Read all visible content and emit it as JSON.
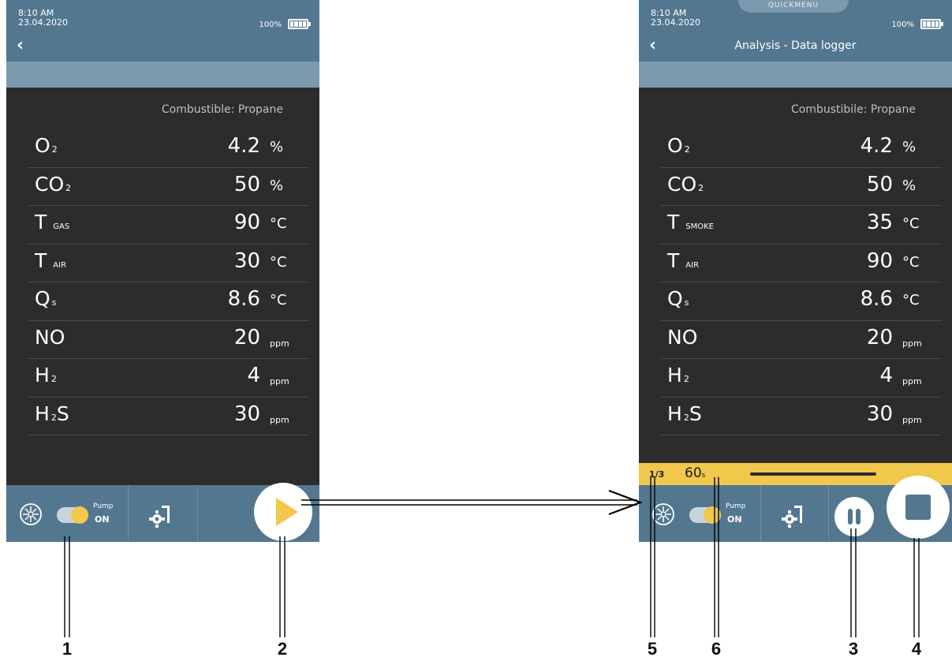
{
  "status": {
    "time": "8:10 AM",
    "date": "23.04.2020",
    "battery_percent": "100%",
    "battery_level": 1.0
  },
  "left_screen": {
    "fuel": "Combustible: Propane",
    "rows": [
      {
        "param": "O",
        "sub": "2",
        "value": "4.2",
        "unit": "%"
      },
      {
        "param": "CO",
        "sub": "2",
        "value": "50",
        "unit": "%"
      },
      {
        "param": "T",
        "sub_label": "GAS",
        "value": "90",
        "unit": "°C"
      },
      {
        "param": "T",
        "sub_label": "AIR",
        "value": "30",
        "unit": "°C"
      },
      {
        "param": "Q",
        "sub": "s",
        "value": "8.6",
        "unit": "°C"
      },
      {
        "param": "NO",
        "value": "20",
        "unit": "ppm"
      },
      {
        "param": "H",
        "sub": "2",
        "value": "4",
        "unit": "ppm"
      },
      {
        "param": "H",
        "sub": "2",
        "tail": "S",
        "value": "30",
        "unit": "ppm"
      }
    ],
    "pump_label": "Pump",
    "pump_state": "ON"
  },
  "right_screen": {
    "quickmenu": "QUICKMENU",
    "title": "Analysis - Data logger",
    "fuel": "Combustibile: Propane",
    "rows": [
      {
        "param": "O",
        "sub": "2",
        "value": "4.2",
        "unit": "%"
      },
      {
        "param": "CO",
        "sub": "2",
        "value": "50",
        "unit": "%"
      },
      {
        "param": "T",
        "sub_label": "SMOKE",
        "value": "35",
        "unit": "°C"
      },
      {
        "param": "T",
        "sub_label": "AIR",
        "value": "90",
        "unit": "°C"
      },
      {
        "param": "Q",
        "sub": "s",
        "value": "8.6",
        "unit": "°C"
      },
      {
        "param": "NO",
        "value": "20",
        "unit": "ppm"
      },
      {
        "param": "H",
        "sub": "2",
        "value": "4",
        "unit": "ppm"
      },
      {
        "param": "H",
        "sub": "2",
        "tail": "S",
        "value": "30",
        "unit": "ppm"
      }
    ],
    "page_indicator": "1/3",
    "timer_value": "60",
    "timer_unit": "s",
    "pump_label": "Pump",
    "pump_state": "ON"
  },
  "callouts": [
    "1",
    "2",
    "3",
    "4",
    "5",
    "6"
  ],
  "colors": {
    "header": "#53778f",
    "subheader": "#7b99ad",
    "background": "#2c2c2c",
    "accent": "#f1c84b"
  }
}
